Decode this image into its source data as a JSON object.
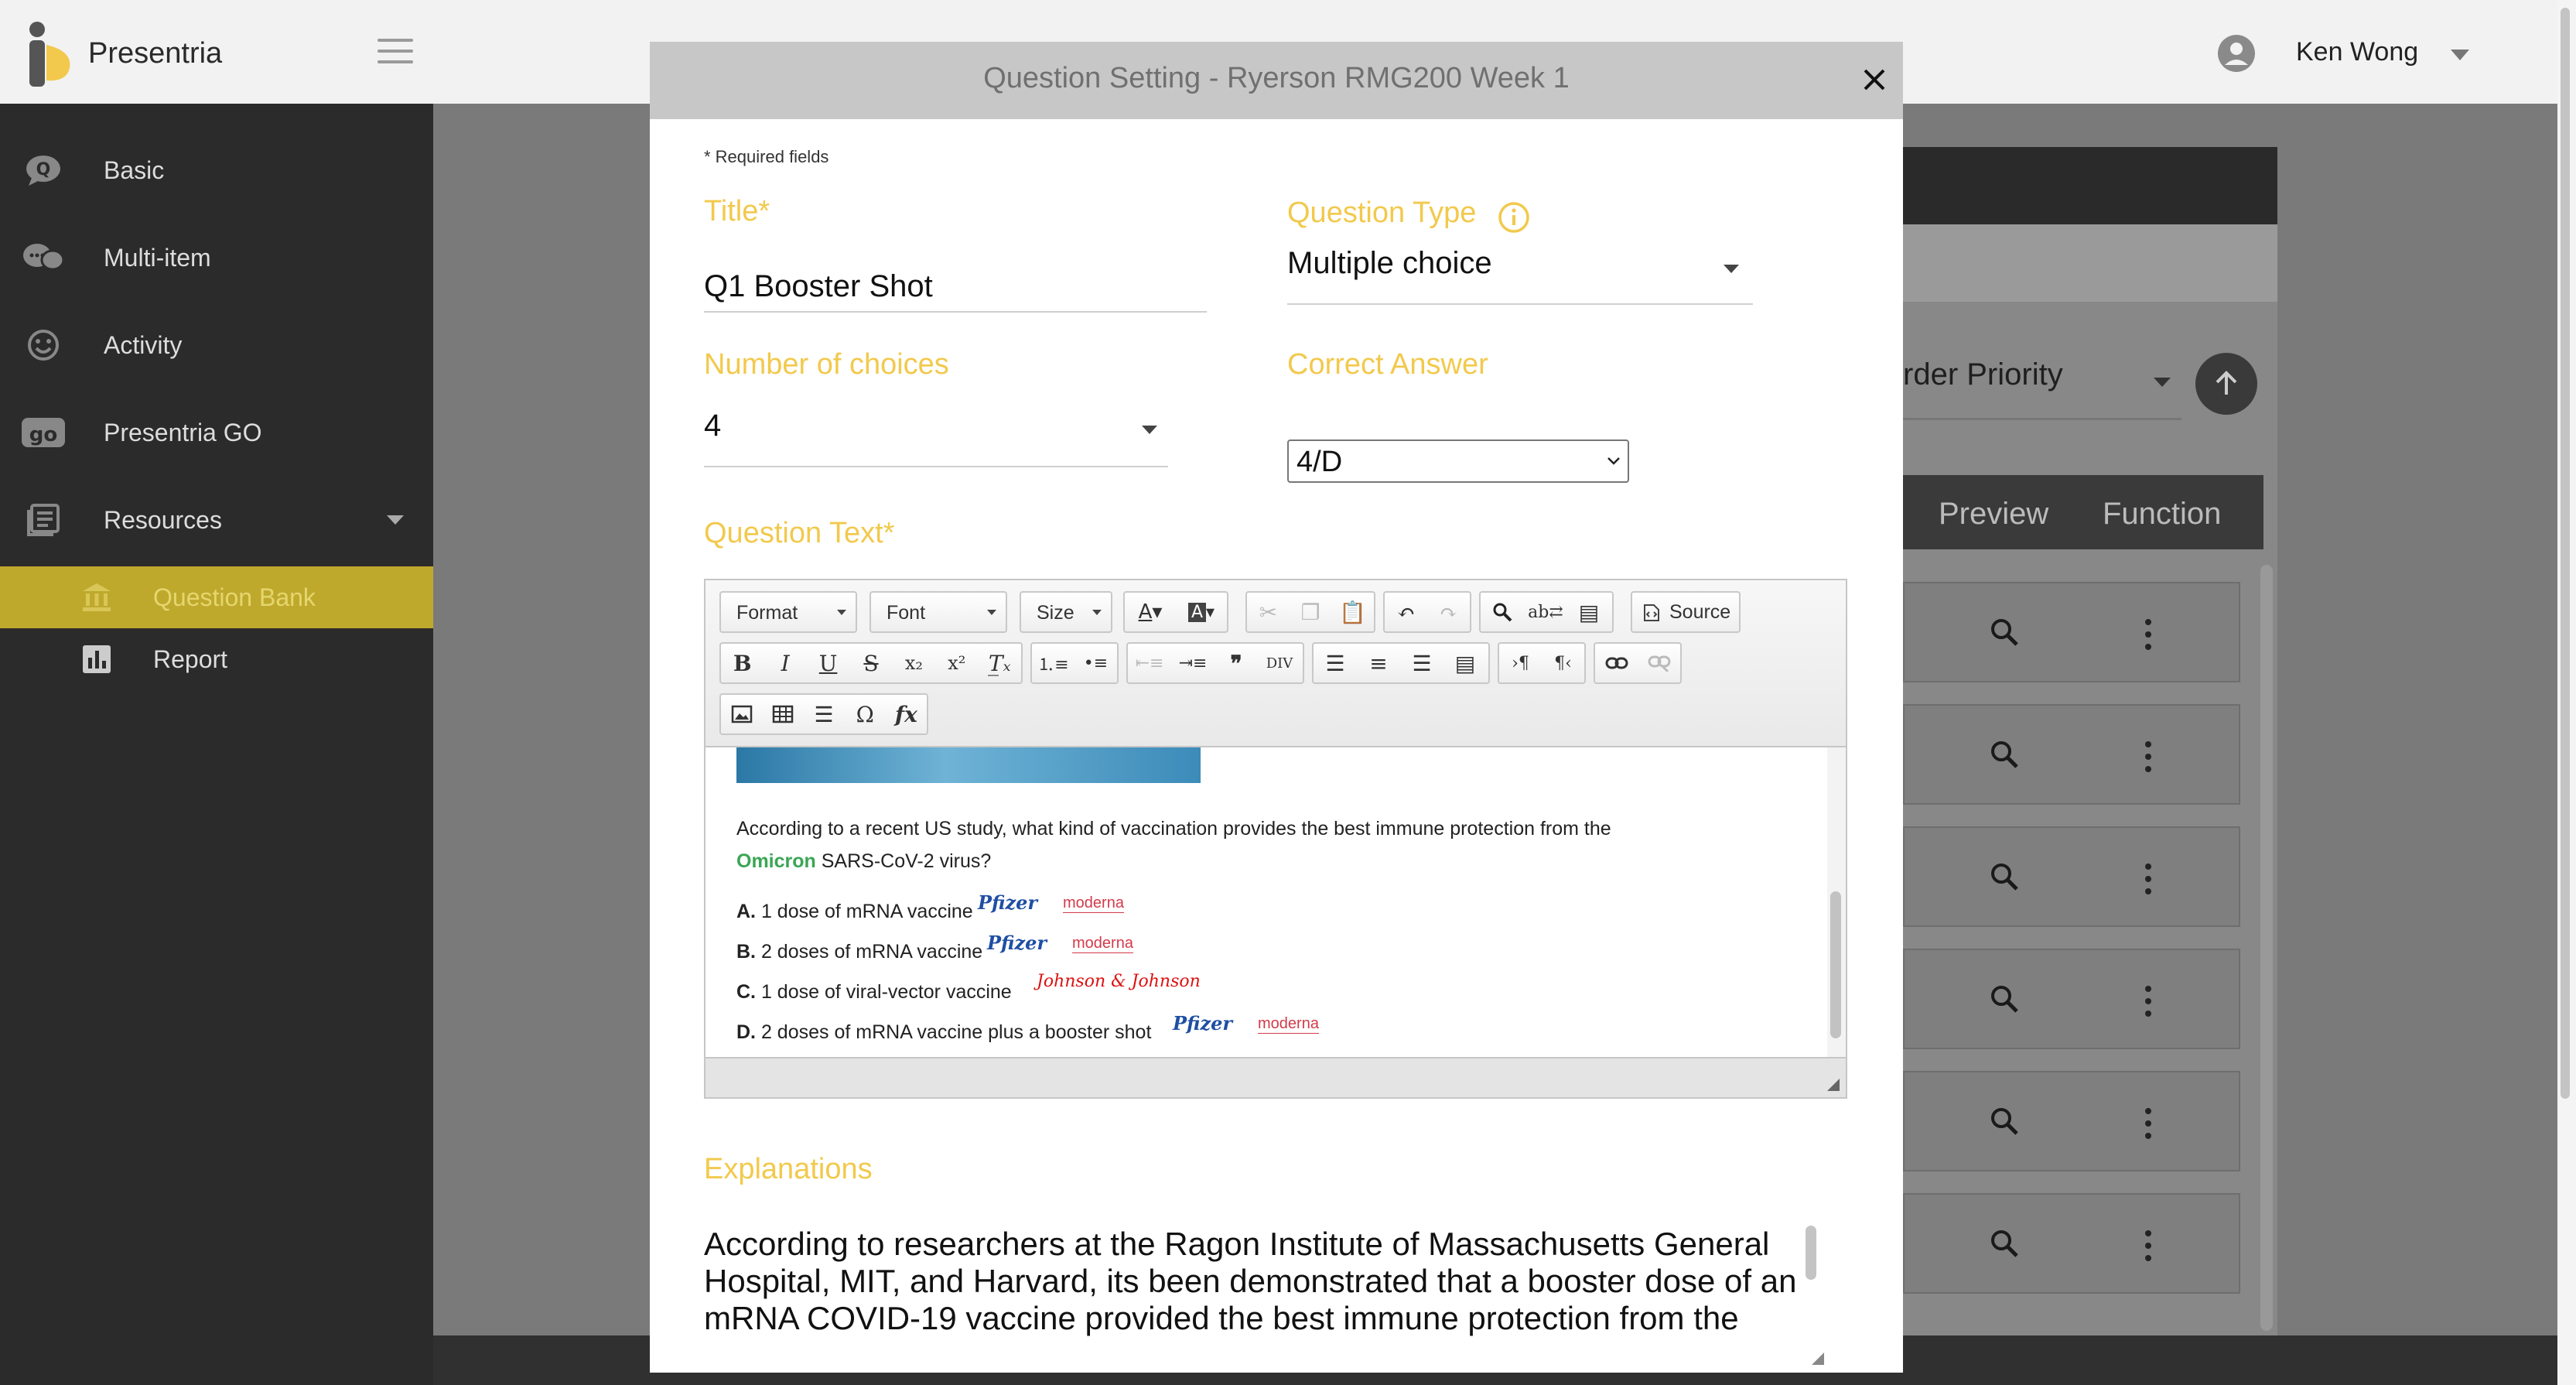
{
  "app": {
    "brand_name": "Presentria",
    "user_name": "Ken Wong",
    "sidebar": {
      "items": [
        {
          "label": "Basic",
          "icon": "q-bubble-icon"
        },
        {
          "label": "Multi-item",
          "icon": "multi-bubble-icon"
        },
        {
          "label": "Activity",
          "icon": "smiley-icon"
        },
        {
          "label": "Presentria GO",
          "icon": "go-icon"
        },
        {
          "label": "Resources",
          "icon": "resources-icon"
        }
      ],
      "sub_items": [
        {
          "label": "Question Bank",
          "icon": "bank-icon",
          "active": true
        },
        {
          "label": "Report",
          "icon": "bar-chart-icon",
          "active": false
        }
      ]
    },
    "background": {
      "sort_label": "rder Priority",
      "table_headers": [
        "Preview",
        "Function"
      ],
      "row_count": 6
    }
  },
  "modal": {
    "title": "Question Setting - Ryerson RMG200 Week 1",
    "required_note": "* Required fields",
    "title_label": "Title*",
    "title_value": "Q1 Booster Shot",
    "question_type_label": "Question Type",
    "question_type_value": "Multiple choice",
    "num_choices_label": "Number of choices",
    "num_choices_value": "4",
    "correct_answer_label": "Correct Answer",
    "correct_answer_value": "4/D",
    "question_text_label": "Question Text*",
    "explanations_label": "Explanations",
    "explanations_text": "According to researchers at the Ragon Institute of Massachusetts General Hospital, MIT, and Harvard, its been demonstrated that a booster dose of an mRNA COVID-19 vaccine provided the best immune protection from the"
  },
  "editor": {
    "toolbar": {
      "format": "Format",
      "font": "Font",
      "size": "Size",
      "source": "Source"
    },
    "content": {
      "question_pre": "According to a recent US study, what kind of vaccination provides the best immune protection from the ",
      "question_highlight": "Omicron",
      "question_post": " SARS-CoV-2 virus?",
      "choices": [
        {
          "letter": "A.",
          "text": "1 dose of mRNA vaccine"
        },
        {
          "letter": "B.",
          "text": "2 doses of mRNA vaccine"
        },
        {
          "letter": "C.",
          "text": "1 dose of viral-vector vaccine"
        },
        {
          "letter": "D.",
          "text": "2 doses of mRNA vaccine plus a booster shot"
        }
      ],
      "logo_pfizer": "Pfizer",
      "logo_moderna": "moderna",
      "logo_jj": "Johnson & Johnson"
    }
  },
  "colors": {
    "accent_label": "#f2c94c",
    "active_nav": "#bfa92d",
    "sidebar_bg": "#2b2b2b",
    "omicron_green": "#3aa655"
  }
}
